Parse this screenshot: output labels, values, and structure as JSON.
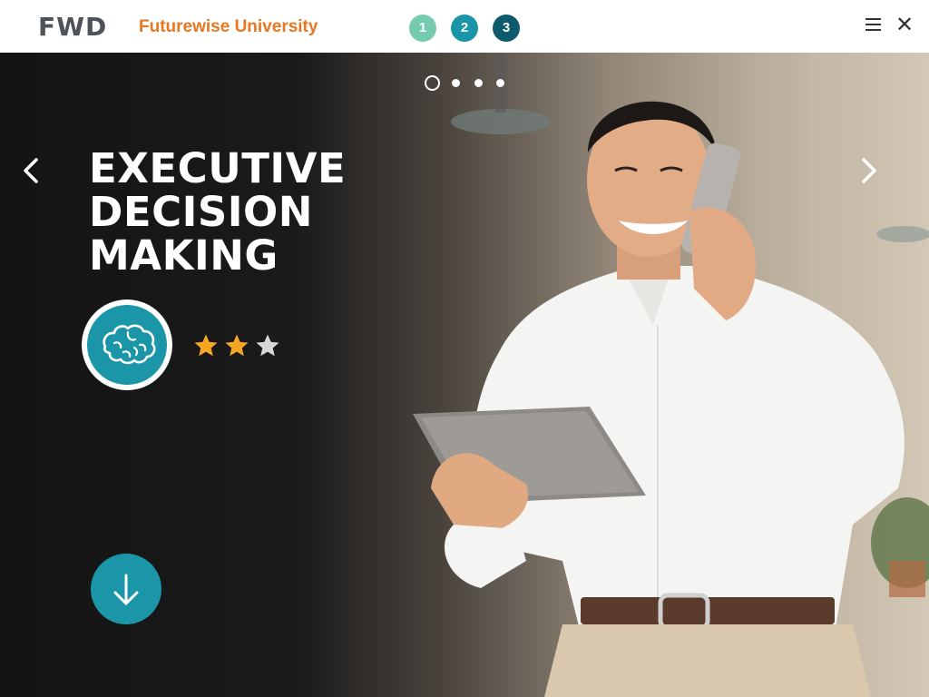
{
  "header": {
    "logo_text": "FWD",
    "brand": "Futurewise University",
    "steps": [
      "1",
      "2",
      "3"
    ]
  },
  "hero": {
    "title_lines": [
      "EXECUTIVE",
      "DECISION",
      "MAKING"
    ],
    "badge_icon": "brain-icon",
    "rating": {
      "value": 2,
      "max": 3
    },
    "carousel": {
      "total": 4,
      "active": 1
    }
  },
  "colors": {
    "brand_orange": "#e87722",
    "teal": "#1b96a8",
    "step1": "#74cbb0",
    "step3": "#0c5a6c",
    "star_filled": "#f5a623",
    "star_empty": "#d8d8d8"
  },
  "icons": {
    "menu": "hamburger-menu-icon",
    "close": "close-icon",
    "prev": "chevron-left-icon",
    "next": "chevron-right-icon",
    "scroll": "arrow-down-icon"
  }
}
